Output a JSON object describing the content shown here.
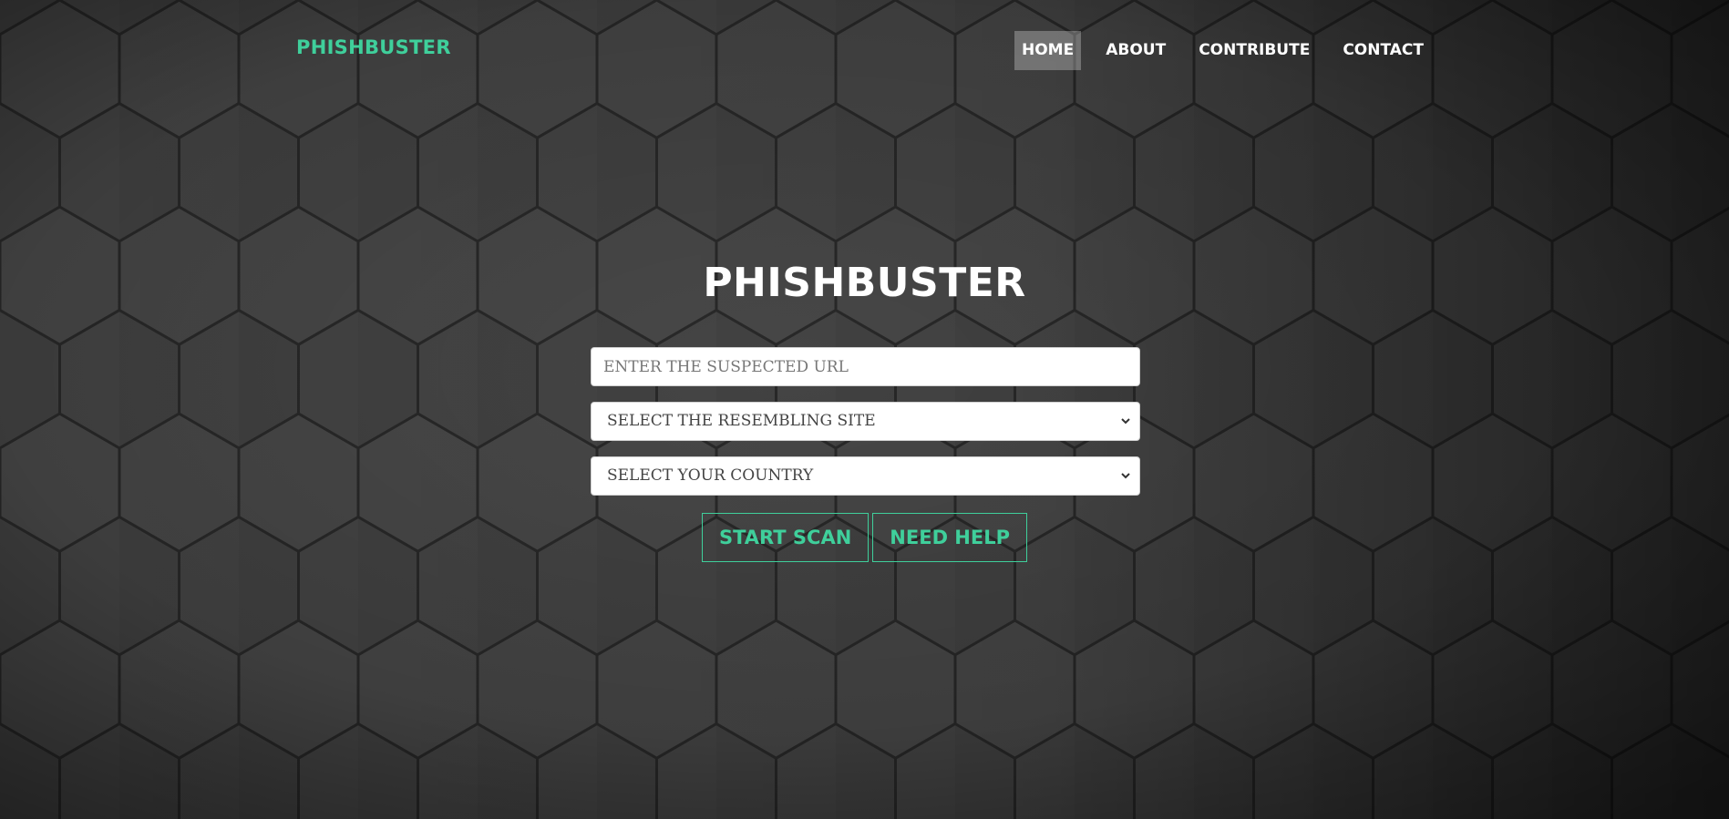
{
  "colors": {
    "accent": "#3fcf9b",
    "nav_text": "#ffffff",
    "background": "#2b2b2b"
  },
  "header": {
    "brand": "PHISHBUSTER",
    "nav": [
      {
        "label": "HOME",
        "active": true
      },
      {
        "label": "ABOUT",
        "active": false
      },
      {
        "label": "CONTRIBUTE",
        "active": false
      },
      {
        "label": "CONTACT",
        "active": false
      }
    ]
  },
  "main": {
    "title": "PHISHBUSTER",
    "url_input": {
      "placeholder": "ENTER THE SUSPECTED URL",
      "value": ""
    },
    "site_select": {
      "selected": "SELECT THE RESEMBLING SITE",
      "icon": "chevron-down-icon"
    },
    "country_select": {
      "selected": "SELECT YOUR COUNTRY",
      "icon": "chevron-down-icon"
    },
    "buttons": {
      "start_scan": "START SCAN",
      "need_help": "NEED HELP"
    }
  }
}
